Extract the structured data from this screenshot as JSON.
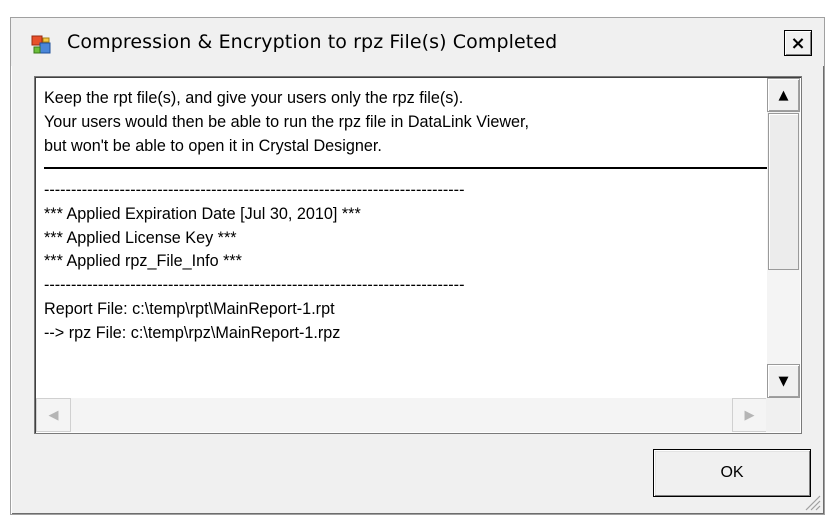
{
  "window": {
    "title": "Compression & Encryption to rpz File(s) Completed",
    "close_glyph": "×",
    "icon": "app-window-icon"
  },
  "message": {
    "lines_top": [
      "Keep the rpt file(s), and give your users only the rpz file(s).",
      "Your users would then be able to run the rpz file in DataLink Viewer,",
      "but won't be able to open it in Crystal Designer."
    ],
    "dash_line": "------------------------------------------------------------------------------",
    "lines_applied": [
      "*** Applied Expiration Date [Jul 30, 2010] ***",
      "*** Applied License Key ***",
      "*** Applied rpz_File_Info ***"
    ],
    "lines_files": [
      "Report File: c:\\temp\\rpt\\MainReport-1.rpt",
      "--> rpz File: c:\\temp\\rpz\\MainReport-1.rpz"
    ]
  },
  "scrollbars": {
    "up_glyph": "▲",
    "down_glyph": "▼",
    "left_glyph": "◀",
    "right_glyph": "▶"
  },
  "buttons": {
    "ok_label": "OK"
  }
}
